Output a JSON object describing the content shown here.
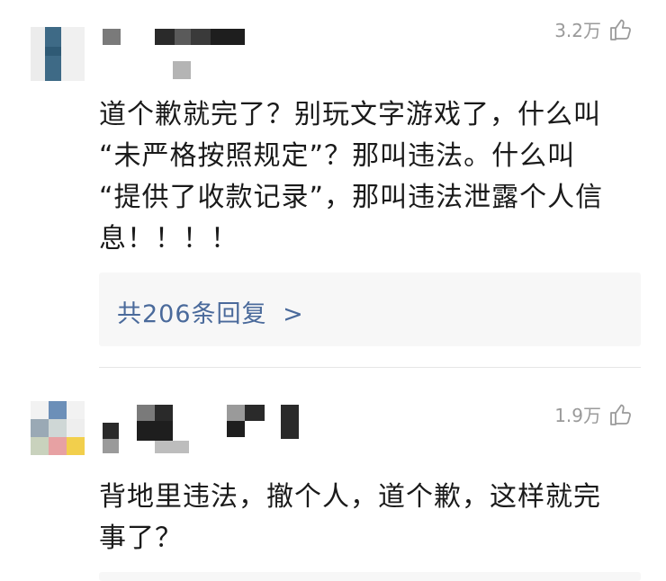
{
  "comments": [
    {
      "likes": "3.2万",
      "text": "道个歉就完了？别玩文字游戏了，什么叫\n“未严格按照规定”？那叫违法。什么叫\n“提供了收款记录”，那叫违法泄露个人信\n息！！！！",
      "replies_label": "共206条回复",
      "replies_chevron": ">"
    },
    {
      "likes": "1.9万",
      "text": "背地里违法，撤个人，道个歉，这样就完\n事了？"
    }
  ],
  "colors": {
    "reply_link": "#4a6a9b",
    "like_count": "#9a9a9a",
    "replies_bg": "#f7f7f7"
  },
  "icons": {
    "like": "thumbs-up-outline-icon"
  }
}
